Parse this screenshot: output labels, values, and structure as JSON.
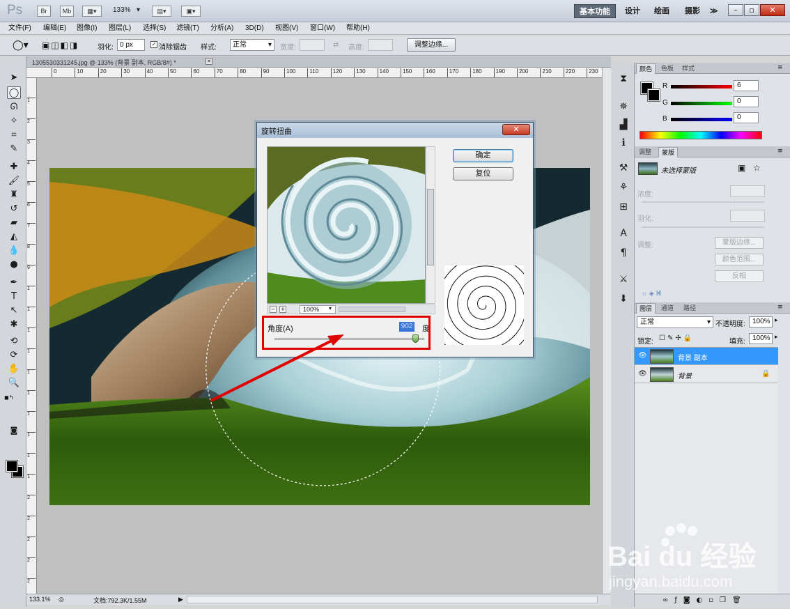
{
  "titlebar": {
    "app_logo": "Ps",
    "bridge_btn": "Br",
    "minibridge_btn": "Mb",
    "zoom": "133%",
    "workspaces": [
      "基本功能",
      "设计",
      "绘画",
      "摄影"
    ],
    "more": "≫",
    "min": "–",
    "restore": "▫",
    "close": "✕"
  },
  "menu": [
    "文件(F)",
    "编辑(E)",
    "图像(I)",
    "图层(L)",
    "选择(S)",
    "滤镜(T)",
    "分析(A)",
    "3D(D)",
    "视图(V)",
    "窗口(W)",
    "帮助(H)"
  ],
  "options": {
    "feather_label": "羽化:",
    "feather_value": "0 px",
    "antialias_label": "消除锯齿",
    "style_label": "样式:",
    "style_value": "正常",
    "width_label": "宽度:",
    "height_label": "高度:",
    "refine_edge": "调整边缘..."
  },
  "document": {
    "tab_title": "1305530331245.jpg @ 133% (背景 副本, RGB/8#) *",
    "tab_close": "✕",
    "ruler_h": [
      "0",
      "10",
      "20",
      "30",
      "40",
      "50",
      "60",
      "70",
      "80",
      "90",
      "100",
      "110",
      "120",
      "130",
      "140",
      "150",
      "160",
      "170",
      "180",
      "190",
      "200",
      "210",
      "220",
      "230"
    ],
    "ruler_v": [
      "1",
      "2",
      "3",
      "4",
      "5",
      "6",
      "7",
      "8",
      "9",
      "1",
      "1",
      "1",
      "1",
      "1",
      "1",
      "1",
      "1",
      "1",
      "1",
      "2",
      "2",
      "2",
      "2",
      "2"
    ],
    "status_zoom": "133.1%",
    "status_doc": "文档:792.3K/1.55M"
  },
  "dialog": {
    "title": "旋转扭曲",
    "ok": "确定",
    "reset": "复位",
    "zoom_minus": "−",
    "zoom_plus": "+",
    "zoom_value": "100%",
    "angle_label": "角度(A)",
    "angle_value": "902",
    "angle_unit": "度",
    "angle_fraction": 0.944
  },
  "color_panel": {
    "tabs": [
      "颜色",
      "色板",
      "样式"
    ],
    "r_label": "R",
    "g_label": "G",
    "b_label": "B",
    "r": "6",
    "g": "0",
    "b": "0"
  },
  "adjust_panel": {
    "tabs": [
      "调整",
      "蒙版"
    ],
    "mask_name": "未选择蒙版",
    "density": "浓度:",
    "feather": "羽化:",
    "refine": "调整:",
    "mask_edge": "蒙版边缘...",
    "color_range": "颜色范围...",
    "invert": "反相"
  },
  "layers_panel": {
    "tabs": [
      "图层",
      "通道",
      "路径"
    ],
    "blend_mode": "正常",
    "opacity_label": "不透明度:",
    "opacity": "100%",
    "lock_label": "锁定:",
    "fill_label": "填充:",
    "fill": "100%",
    "layers": [
      {
        "name": "背景 副本",
        "selected": true
      },
      {
        "name": "背景",
        "selected": false
      }
    ]
  },
  "watermark": {
    "logo": "Bai du 经验",
    "url": "jingyan.baidu.com"
  },
  "colors": {
    "highlight": "#e00000",
    "selected_layer": "#3399ff",
    "workspace_active": "#5e6a78"
  }
}
